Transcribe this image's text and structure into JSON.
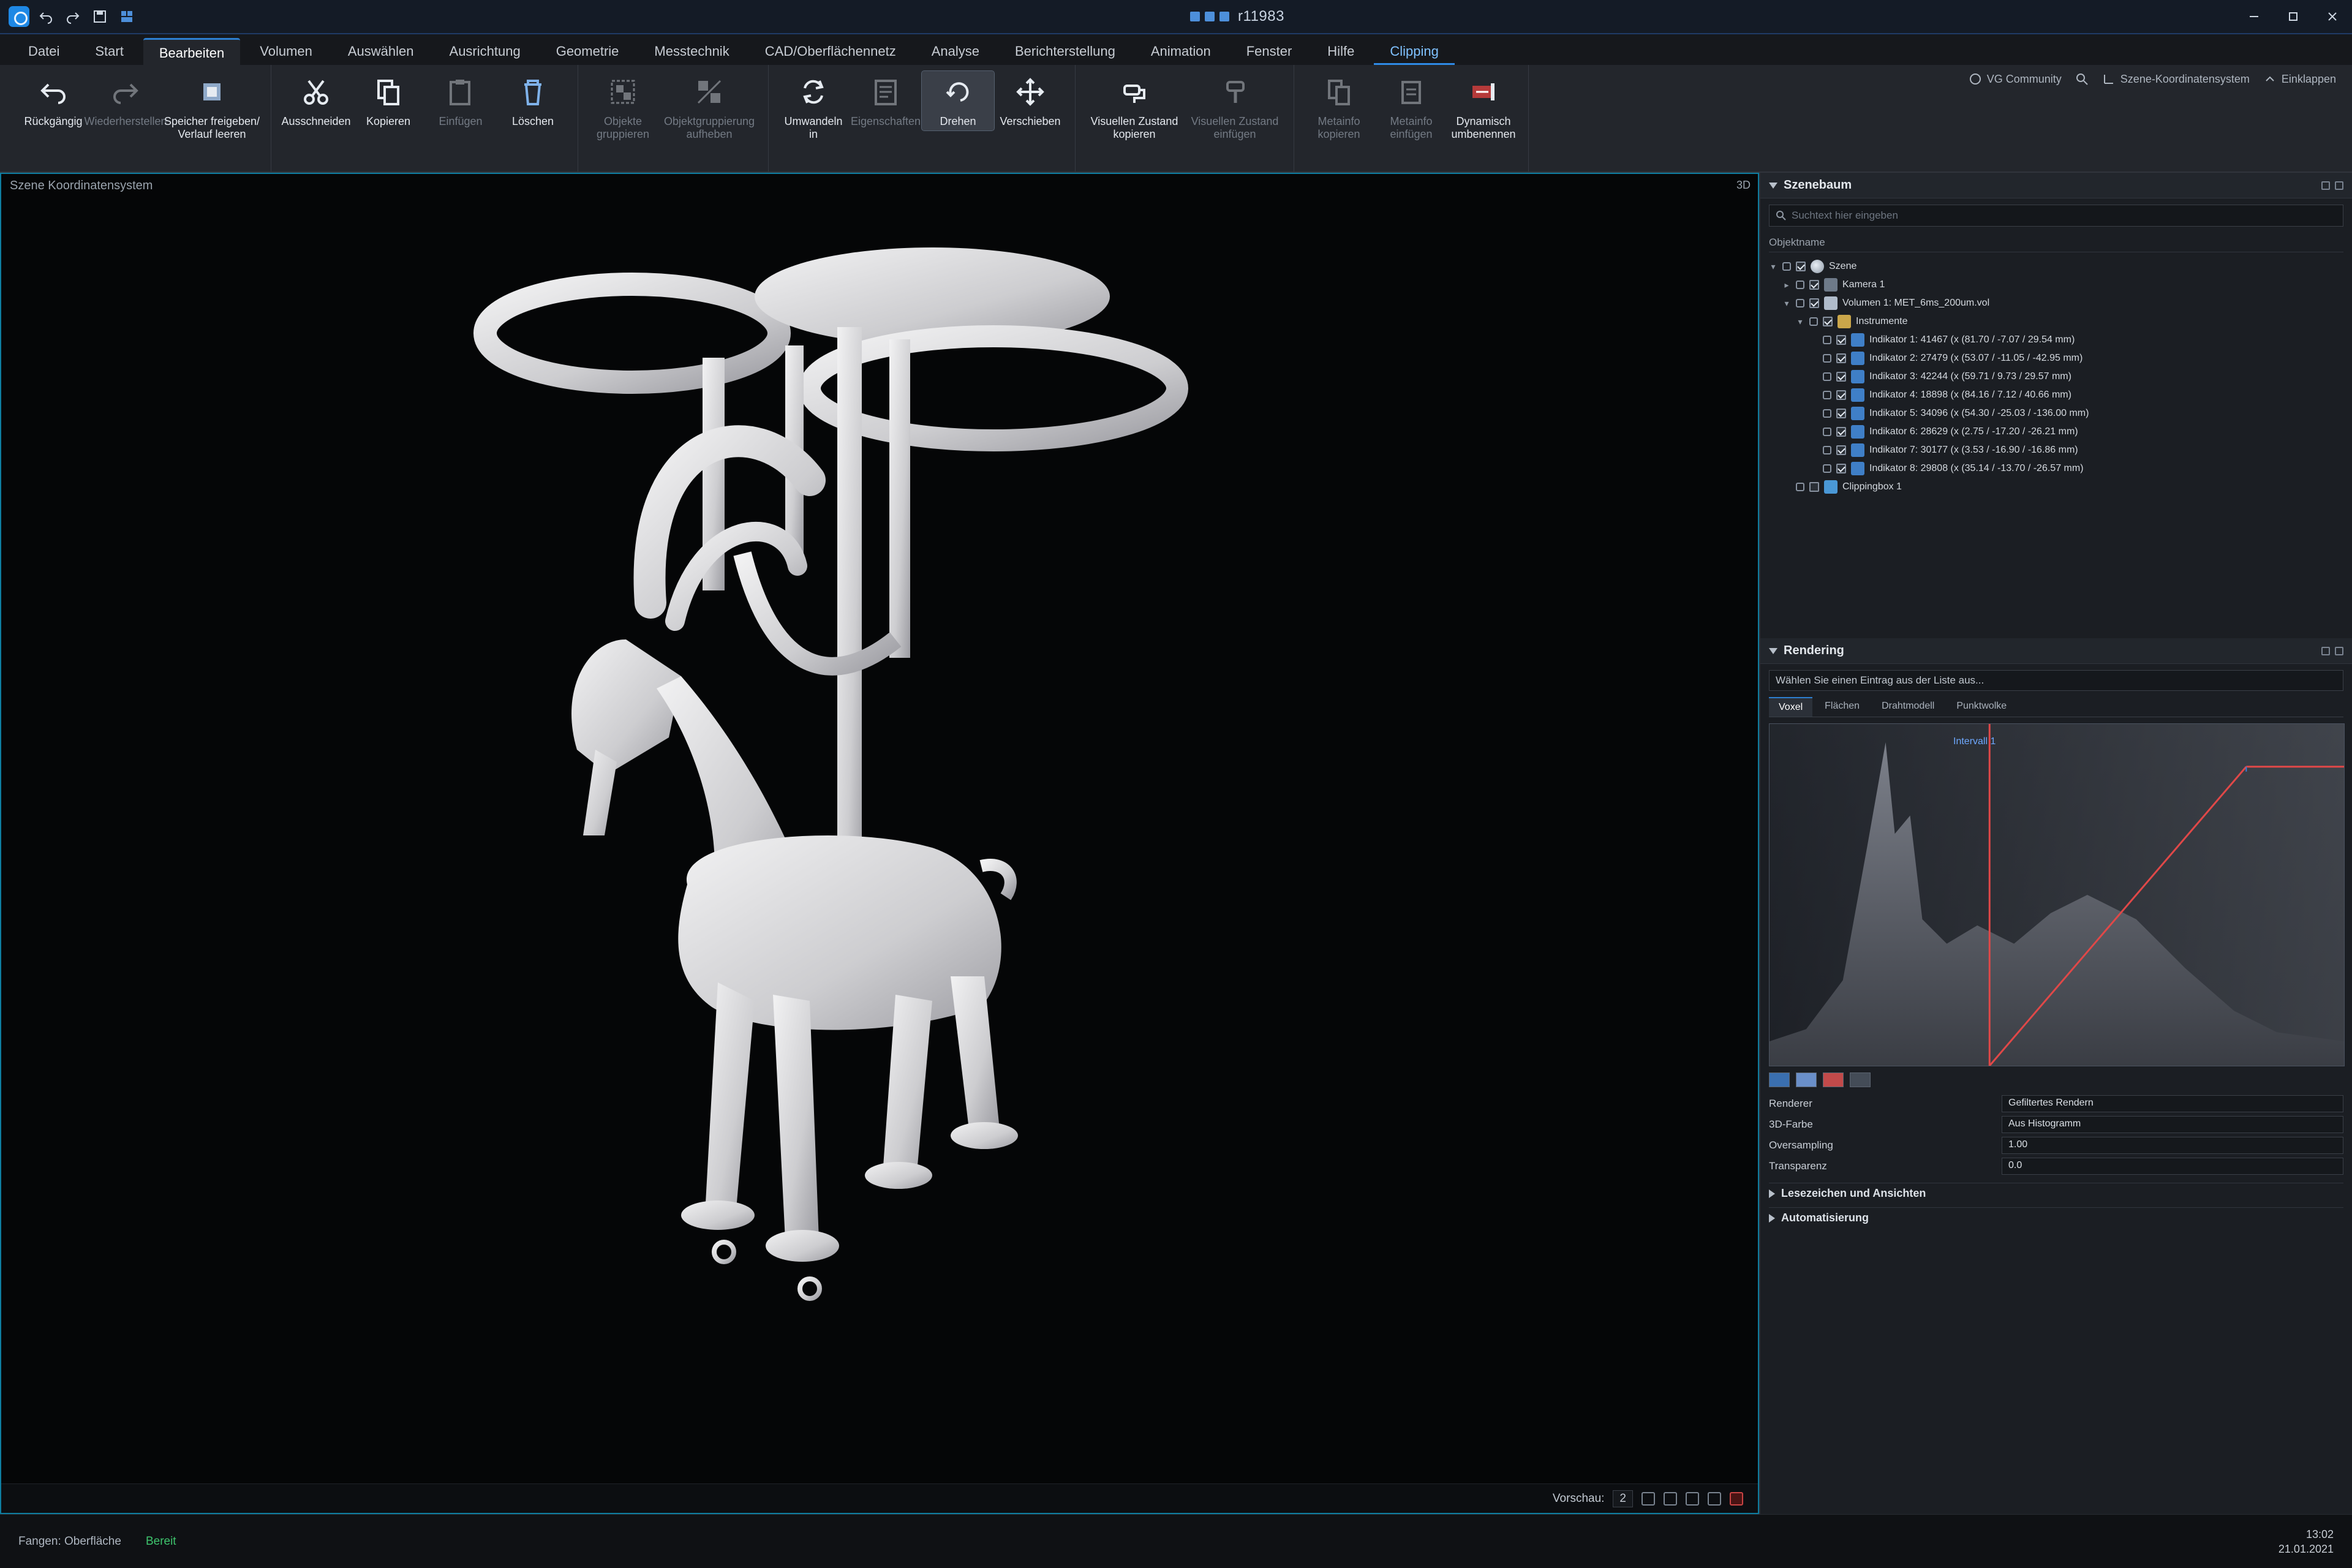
{
  "window": {
    "title": "r11983",
    "quick_access_icons": [
      "undo-icon",
      "redo-icon",
      "save-icon",
      "layout-icon"
    ]
  },
  "tabs": [
    {
      "label": "Datei",
      "active": false,
      "contextual": false
    },
    {
      "label": "Start",
      "active": false,
      "contextual": false
    },
    {
      "label": "Bearbeiten",
      "active": true,
      "contextual": false
    },
    {
      "label": "Volumen",
      "active": false,
      "contextual": false
    },
    {
      "label": "Auswählen",
      "active": false,
      "contextual": false
    },
    {
      "label": "Ausrichtung",
      "active": false,
      "contextual": false
    },
    {
      "label": "Geometrie",
      "active": false,
      "contextual": false
    },
    {
      "label": "Messtechnik",
      "active": false,
      "contextual": false
    },
    {
      "label": "CAD/Oberflächennetz",
      "active": false,
      "contextual": false
    },
    {
      "label": "Analyse",
      "active": false,
      "contextual": false
    },
    {
      "label": "Berichterstellung",
      "active": false,
      "contextual": false
    },
    {
      "label": "Animation",
      "active": false,
      "contextual": false
    },
    {
      "label": "Fenster",
      "active": false,
      "contextual": false
    },
    {
      "label": "Hilfe",
      "active": false,
      "contextual": false
    },
    {
      "label": "Clipping",
      "active": false,
      "contextual": true
    }
  ],
  "ribbon": {
    "groups": [
      {
        "buttons": [
          {
            "label": "Rückgängig",
            "icon": "undo-icon",
            "enabled": true
          },
          {
            "label": "Wiederherstellen",
            "icon": "redo-icon",
            "enabled": false
          },
          {
            "label": "Speicher freigeben/\nVerlauf leeren",
            "icon": "chip-icon",
            "enabled": true,
            "wide": true
          }
        ]
      },
      {
        "buttons": [
          {
            "label": "Ausschneiden",
            "icon": "scissors-icon",
            "enabled": true
          },
          {
            "label": "Kopieren",
            "icon": "copy-icon",
            "enabled": true
          },
          {
            "label": "Einfügen",
            "icon": "paste-icon",
            "enabled": false
          },
          {
            "label": "Löschen",
            "icon": "trash-icon",
            "enabled": true
          }
        ]
      },
      {
        "buttons": [
          {
            "label": "Objekte\ngruppieren",
            "icon": "group-icon",
            "enabled": false
          },
          {
            "label": "Objektgruppierung\naufheben",
            "icon": "ungroup-icon",
            "enabled": false,
            "wide": true
          }
        ]
      },
      {
        "buttons": [
          {
            "label": "Umwandeln\nin",
            "icon": "convert-icon",
            "enabled": true
          },
          {
            "label": "Eigenschaften",
            "icon": "properties-icon",
            "enabled": false
          },
          {
            "label": "Drehen",
            "icon": "rotate-icon",
            "enabled": true,
            "selected": true
          },
          {
            "label": "Verschieben",
            "icon": "move-icon",
            "enabled": true
          }
        ]
      },
      {
        "buttons": [
          {
            "label": "Visuellen Zustand\nkopieren",
            "icon": "copy-state-icon",
            "enabled": true,
            "wide": true
          },
          {
            "label": "Visuellen Zustand\neinfügen",
            "icon": "paste-state-icon",
            "enabled": false,
            "wide": true
          }
        ]
      },
      {
        "buttons": [
          {
            "label": "Metainfo\nkopieren",
            "icon": "meta-copy-icon",
            "enabled": false
          },
          {
            "label": "Metainfo\neinfügen",
            "icon": "meta-paste-icon",
            "enabled": false
          },
          {
            "label": "Dynamisch\numbenennen",
            "icon": "rename-icon",
            "enabled": true
          }
        ]
      }
    ],
    "right": {
      "community": "VG Community",
      "coords": "Szene-Koordinatensystem",
      "minimize": "Einklappen"
    }
  },
  "viewport": {
    "caption": "Szene Koordinatensystem",
    "tag": "3D",
    "preview_label": "Vorschau:",
    "preview_value": "2"
  },
  "scene_panel": {
    "title": "Szenebaum",
    "search_placeholder": "Suchtext hier eingeben",
    "column_header": "Objektname",
    "tree": [
      {
        "label": "Szene",
        "level": 0,
        "icon": "scene",
        "toggle": "▾",
        "checked": true
      },
      {
        "label": "Kamera 1",
        "level": 1,
        "icon": "cam",
        "toggle": "▸",
        "checked": true
      },
      {
        "label": "Volumen 1: MET_6ms_200um.vol",
        "level": 1,
        "icon": "vol",
        "toggle": "▾",
        "checked": true
      },
      {
        "label": "Instrumente",
        "level": 2,
        "icon": "folder",
        "toggle": "▾",
        "checked": true
      },
      {
        "label": "Indikator 1: 41467 (x (81.70 / -7.07 / 29.54 mm)",
        "level": 3,
        "icon": "ind",
        "toggle": "",
        "checked": true
      },
      {
        "label": "Indikator 2: 27479 (x (53.07 / -11.05 / -42.95 mm)",
        "level": 3,
        "icon": "ind",
        "toggle": "",
        "checked": true
      },
      {
        "label": "Indikator 3: 42244 (x (59.71 / 9.73 / 29.57 mm)",
        "level": 3,
        "icon": "ind",
        "toggle": "",
        "checked": true
      },
      {
        "label": "Indikator 4: 18898 (x (84.16 / 7.12 / 40.66 mm)",
        "level": 3,
        "icon": "ind",
        "toggle": "",
        "checked": true
      },
      {
        "label": "Indikator 5: 34096 (x (54.30 / -25.03 / -136.00 mm)",
        "level": 3,
        "icon": "ind",
        "toggle": "",
        "checked": true
      },
      {
        "label": "Indikator 6: 28629 (x (2.75 / -17.20 / -26.21 mm)",
        "level": 3,
        "icon": "ind",
        "toggle": "",
        "checked": true
      },
      {
        "label": "Indikator 7: 30177 (x (3.53 / -16.90 / -16.86 mm)",
        "level": 3,
        "icon": "ind",
        "toggle": "",
        "checked": true
      },
      {
        "label": "Indikator 8: 29808 (x (35.14 / -13.70 / -26.57 mm)",
        "level": 3,
        "icon": "ind",
        "toggle": "",
        "checked": true
      },
      {
        "label": "Clippingbox 1",
        "level": 1,
        "icon": "clip",
        "toggle": "",
        "checked": false
      }
    ]
  },
  "render_panel": {
    "title": "Rendering",
    "selector_text": "Wählen Sie einen Eintrag aus der Liste aus...",
    "tabs": [
      "Voxel",
      "Flächen",
      "Drahtmodell",
      "Punktwolke"
    ],
    "active_tab": "Voxel",
    "interval_label": "Intervall 1",
    "swatch_colors": [
      "#3a6fb0",
      "#6a8fc9",
      "#c24a4a",
      "#444c57"
    ],
    "properties": [
      {
        "key": "Renderer",
        "value": "Gefiltertes Rendern"
      },
      {
        "key": "3D-Farbe",
        "value": "Aus Histogramm"
      },
      {
        "key": "Oversampling",
        "value": "1.00"
      },
      {
        "key": "Transparenz",
        "value": "0.0"
      }
    ],
    "collapsed_sections": [
      "Lesezeichen und Ansichten",
      "Automatisierung"
    ]
  },
  "status_bar": {
    "render_mode": "Fangen: Oberfläche",
    "state": "Bereit",
    "state_color": "#3ec46d",
    "time": "13:02",
    "date": "21.01.2021"
  }
}
